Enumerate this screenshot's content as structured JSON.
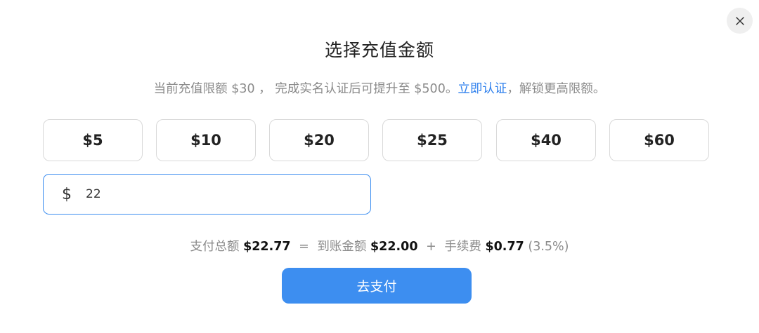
{
  "dialog": {
    "title": "选择充值金额",
    "close_icon": "close-icon"
  },
  "notice": {
    "prefix": "当前充值限额 $30 ， 完成实名认证后可提升至 $500。",
    "link": "立即认证",
    "suffix": "，解锁更高限额。"
  },
  "amount_options": [
    "$5",
    "$10",
    "$20",
    "$25",
    "$40",
    "$60"
  ],
  "custom_amount": {
    "currency_symbol": "$",
    "value": "22"
  },
  "summary": {
    "total_label": "支付总额",
    "total_value": "$22.77",
    "equals": "=",
    "received_label": "到账金额",
    "received_value": "$22.00",
    "plus": "+",
    "fee_label": "手续费",
    "fee_value": "$0.77",
    "fee_rate": "(3.5%)"
  },
  "pay_button": {
    "label": "去支付",
    "color": "#3d8ef0"
  }
}
